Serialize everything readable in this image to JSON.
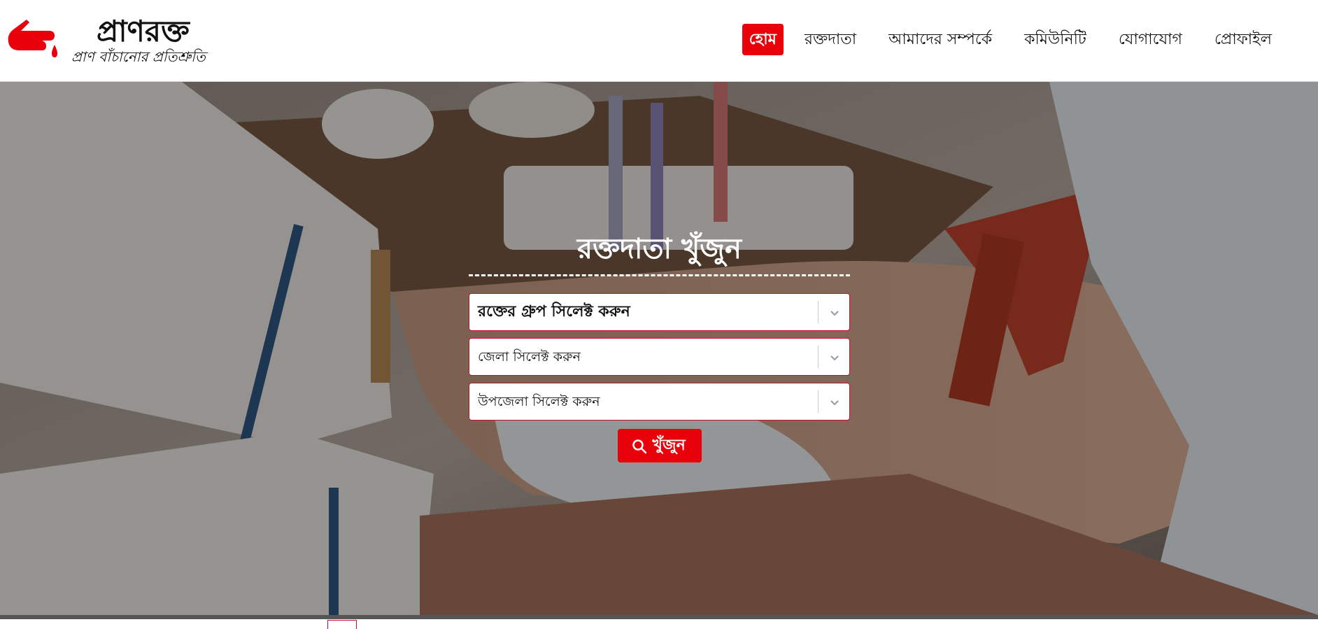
{
  "brand": {
    "name": "প্রাণরক্ত",
    "tagline": "প্রাণ বাঁচানোর প্রতিশ্রুতি"
  },
  "nav": {
    "items": [
      {
        "label": "হোম",
        "active": true
      },
      {
        "label": "রক্তদাতা",
        "active": false
      },
      {
        "label": "আমাদের সম্পর্কে",
        "active": false
      },
      {
        "label": "কমিউনিটি",
        "active": false
      },
      {
        "label": "যোগাযোগ",
        "active": false
      },
      {
        "label": "প্রোফাইল",
        "active": false
      }
    ]
  },
  "search": {
    "title": "রক্তদাতা খুঁজুন",
    "blood_group_placeholder": "রক্তের গ্রুপ সিলেক্ট করুন",
    "district_placeholder": "জেলা সিলেক্ট করুন",
    "upazila_placeholder": "উপজেলা সিলেক্ট করুন",
    "button_label": "খুঁজুন"
  },
  "colors": {
    "accent": "#e8000b",
    "border": "#c8102e"
  }
}
